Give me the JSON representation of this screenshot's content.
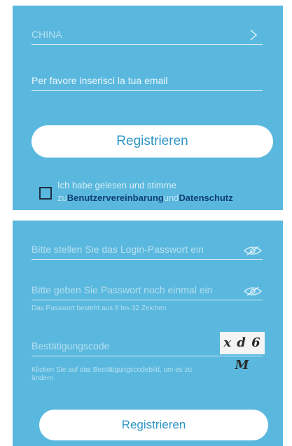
{
  "signup": {
    "country_value": "CHINA",
    "email_placeholder": "Per favore inserisci la tua email",
    "register_label": "Registrieren",
    "agreement": {
      "line1": "Ich habe gelesen und stimme",
      "prefix": "zu",
      "link_terms": "Benutzervereinbarung",
      "connector": "und",
      "link_privacy": "Datenschutz"
    }
  },
  "password_form": {
    "password_placeholder": "Bitte stellen Sie das Login-Passwort ein",
    "password_confirm_placeholder": "Bitte geben Sie Passwort noch einmal ein",
    "password_hint": "Das Passwort besteht aus 8 bis 32 Zeichen",
    "captcha_placeholder": "Bestätigungscode",
    "captcha_code": "x d 6 M",
    "captcha_hint": "Klicken Sie auf das Bestätigungscodebild, um es zu ändern",
    "register_label": "Registrieren"
  },
  "colors": {
    "panel_background": "#5ab8de",
    "button_background": "#ffffff",
    "button_text": "#2e95c6",
    "link_text": "#0f3f73"
  },
  "icons": {
    "country_chevron": "chevron-right-icon",
    "password_visibility": "eye-off-icon"
  }
}
